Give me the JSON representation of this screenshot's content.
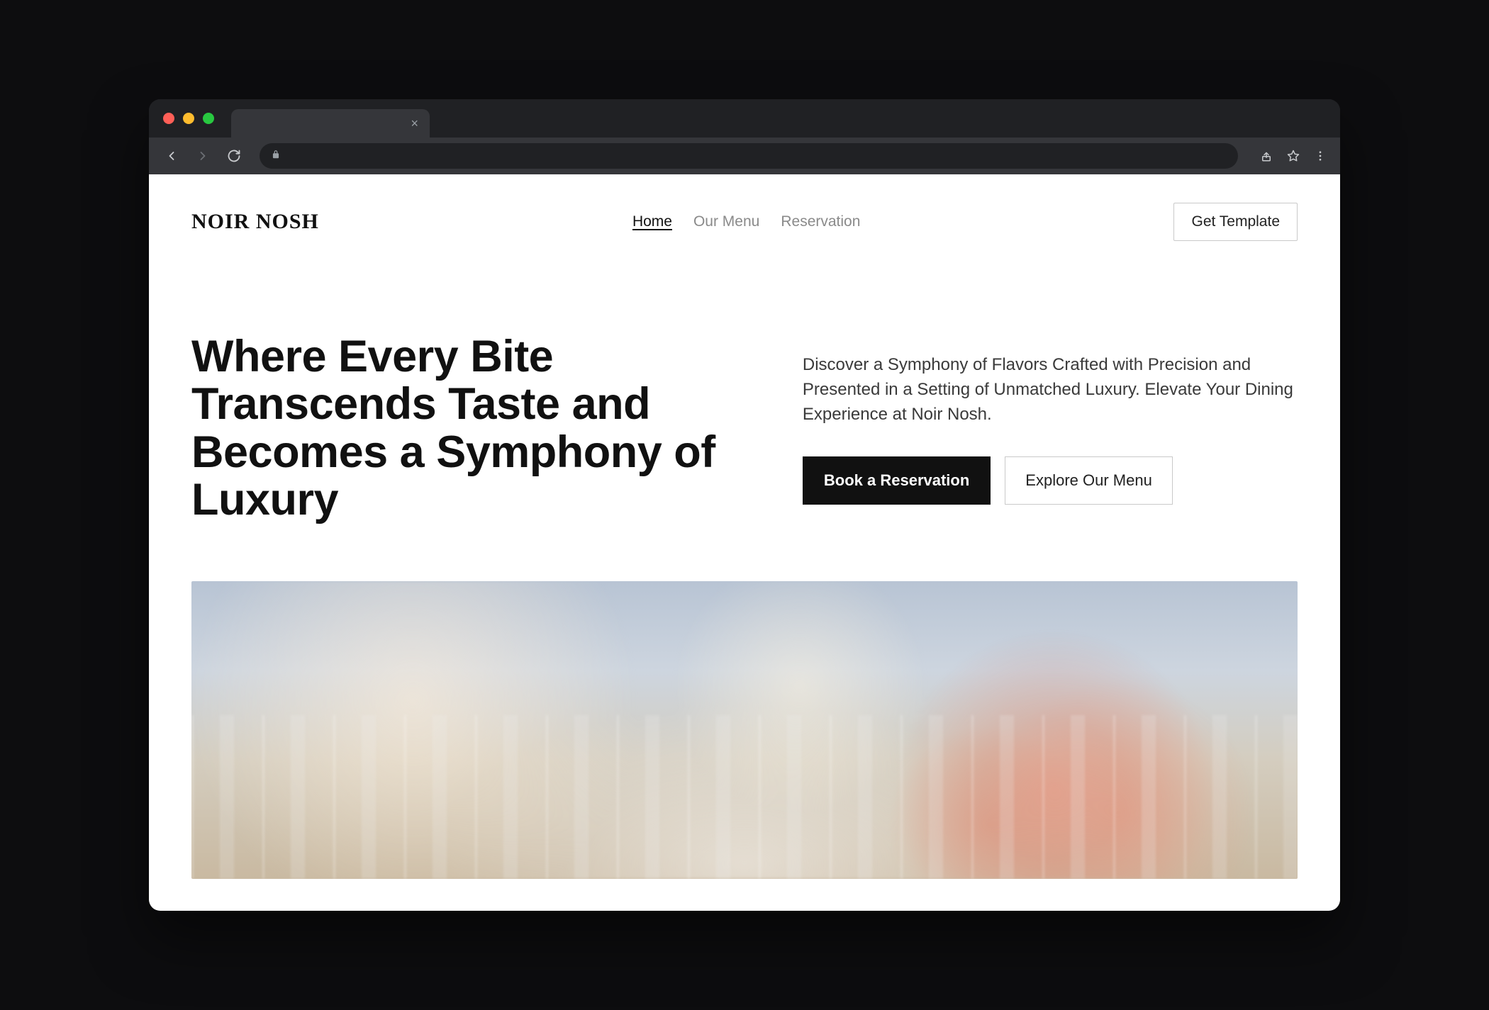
{
  "browser": {
    "traffic_lights": [
      "close",
      "minimize",
      "maximize"
    ]
  },
  "site": {
    "logo": "NOIR NOSH",
    "nav": {
      "home": "Home",
      "menu": "Our Menu",
      "reservation": "Reservation"
    },
    "cta": "Get Template"
  },
  "hero": {
    "headline": "Where Every Bite Transcends Taste and Becomes a Symphony of Luxury",
    "subcopy": "Discover a Symphony of Flavors Crafted with Precision and Presented in a Setting of Unmatched Luxury. Elevate Your Dining Experience at Noir Nosh.",
    "primary_button": "Book a Reservation",
    "secondary_button": "Explore Our Menu",
    "image_alt": "Elegant restaurant dining room with gold chairs, white tablecloths, wine glasses, and pink roses"
  }
}
